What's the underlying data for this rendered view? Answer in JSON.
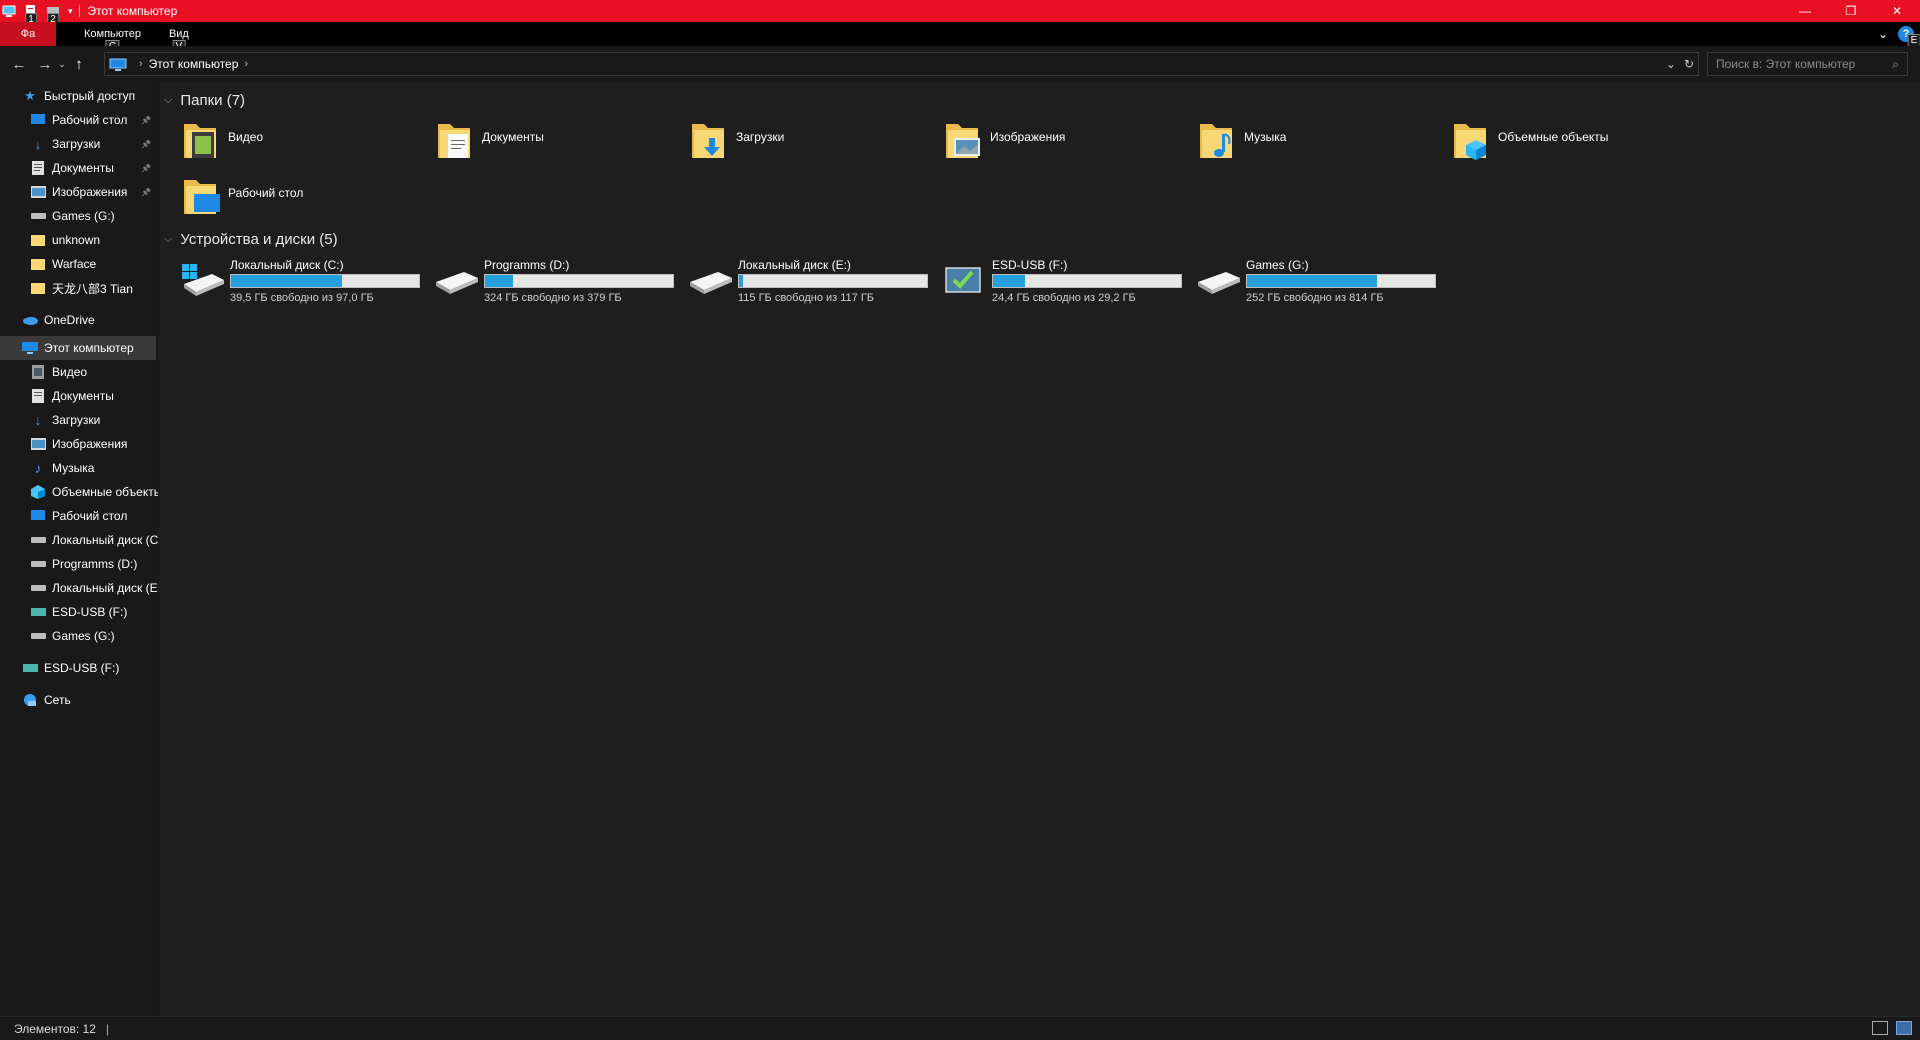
{
  "window": {
    "title": "Этот компьютер",
    "accent_color": "#e81123",
    "controls": [
      "minimize-icon",
      "restore-icon",
      "close-icon"
    ]
  },
  "ribbon": {
    "file_tab": "Фа",
    "file_keytip": "1",
    "qa_keytip": "2",
    "tabs": [
      {
        "label": "Компьютер",
        "keytip": "C"
      },
      {
        "label": "Вид",
        "keytip": "V"
      }
    ],
    "help_label": "?",
    "help_keytip": "E"
  },
  "address": {
    "path": "Этот компьютер",
    "search_placeholder": "Поиск в: Этот компьютер"
  },
  "sidebar": {
    "quick_access": {
      "label": "Быстрый доступ",
      "items": [
        {
          "label": "Рабочий стол",
          "icon": "desktop-icon",
          "pinned": true
        },
        {
          "label": "Загрузки",
          "icon": "download-icon",
          "pinned": true
        },
        {
          "label": "Документы",
          "icon": "documents-icon",
          "pinned": true
        },
        {
          "label": "Изображения",
          "icon": "pictures-icon",
          "pinned": true
        },
        {
          "label": "Games (G:)",
          "icon": "drive-icon",
          "pinned": false
        },
        {
          "label": "unknown",
          "icon": "folder-icon",
          "pinned": false
        },
        {
          "label": "Warface",
          "icon": "folder-icon",
          "pinned": false
        },
        {
          "label": "天龙八部3 Tian",
          "icon": "folder-icon",
          "pinned": false
        }
      ]
    },
    "onedrive": "OneDrive",
    "this_pc": {
      "label": "Этот компьютер",
      "items": [
        {
          "label": "Видео",
          "icon": "video-icon"
        },
        {
          "label": "Документы",
          "icon": "documents-icon"
        },
        {
          "label": "Загрузки",
          "icon": "download-icon"
        },
        {
          "label": "Изображения",
          "icon": "pictures-icon"
        },
        {
          "label": "Музыка",
          "icon": "music-icon"
        },
        {
          "label": "Объемные объекты",
          "icon": "3d-objects-icon"
        },
        {
          "label": "Рабочий стол",
          "icon": "desktop-icon"
        },
        {
          "label": "Локальный диск (C:)",
          "icon": "drive-icon"
        },
        {
          "label": "Programms (D:)",
          "icon": "drive-icon"
        },
        {
          "label": "Локальный диск (E:)",
          "icon": "drive-icon"
        },
        {
          "label": "ESD-USB (F:)",
          "icon": "usb-drive-icon"
        },
        {
          "label": "Games (G:)",
          "icon": "drive-icon"
        }
      ]
    },
    "esd_usb": "ESD-USB (F:)",
    "network": "Сеть",
    "pin_glyph": "📌"
  },
  "main": {
    "folders_header": "Папки (7)",
    "folders": [
      {
        "label": "Видео",
        "icon": "video-folder-icon"
      },
      {
        "label": "Документы",
        "icon": "documents-folder-icon"
      },
      {
        "label": "Загрузки",
        "icon": "downloads-folder-icon"
      },
      {
        "label": "Изображения",
        "icon": "pictures-folder-icon"
      },
      {
        "label": "Музыка",
        "icon": "music-folder-icon"
      },
      {
        "label": "Объемные объекты",
        "icon": "3d-objects-folder-icon"
      },
      {
        "label": "Рабочий стол",
        "icon": "desktop-folder-icon"
      }
    ],
    "drives_header": "Устройства и диски (5)",
    "drives": [
      {
        "label": "Локальный диск (C:)",
        "free": "39,5 ГБ свободно из 97,0 ГБ",
        "used_fraction": 0.59,
        "icon": "windows-drive-icon"
      },
      {
        "label": "Programms (D:)",
        "free": "324 ГБ свободно из 379 ГБ",
        "used_fraction": 0.15,
        "icon": "drive-icon"
      },
      {
        "label": "Локальный диск (E:)",
        "free": "115 ГБ свободно из 117 ГБ",
        "used_fraction": 0.02,
        "icon": "drive-icon"
      },
      {
        "label": "ESD-USB (F:)",
        "free": "24,4 ГБ свободно из 29,2 ГБ",
        "used_fraction": 0.17,
        "icon": "usb-setup-drive-icon"
      },
      {
        "label": "Games (G:)",
        "free": "252 ГБ свободно из 814 ГБ",
        "used_fraction": 0.69,
        "icon": "drive-icon"
      }
    ],
    "bar_color": "#26a0da"
  },
  "status": {
    "items_count": "Элементов: 12"
  }
}
